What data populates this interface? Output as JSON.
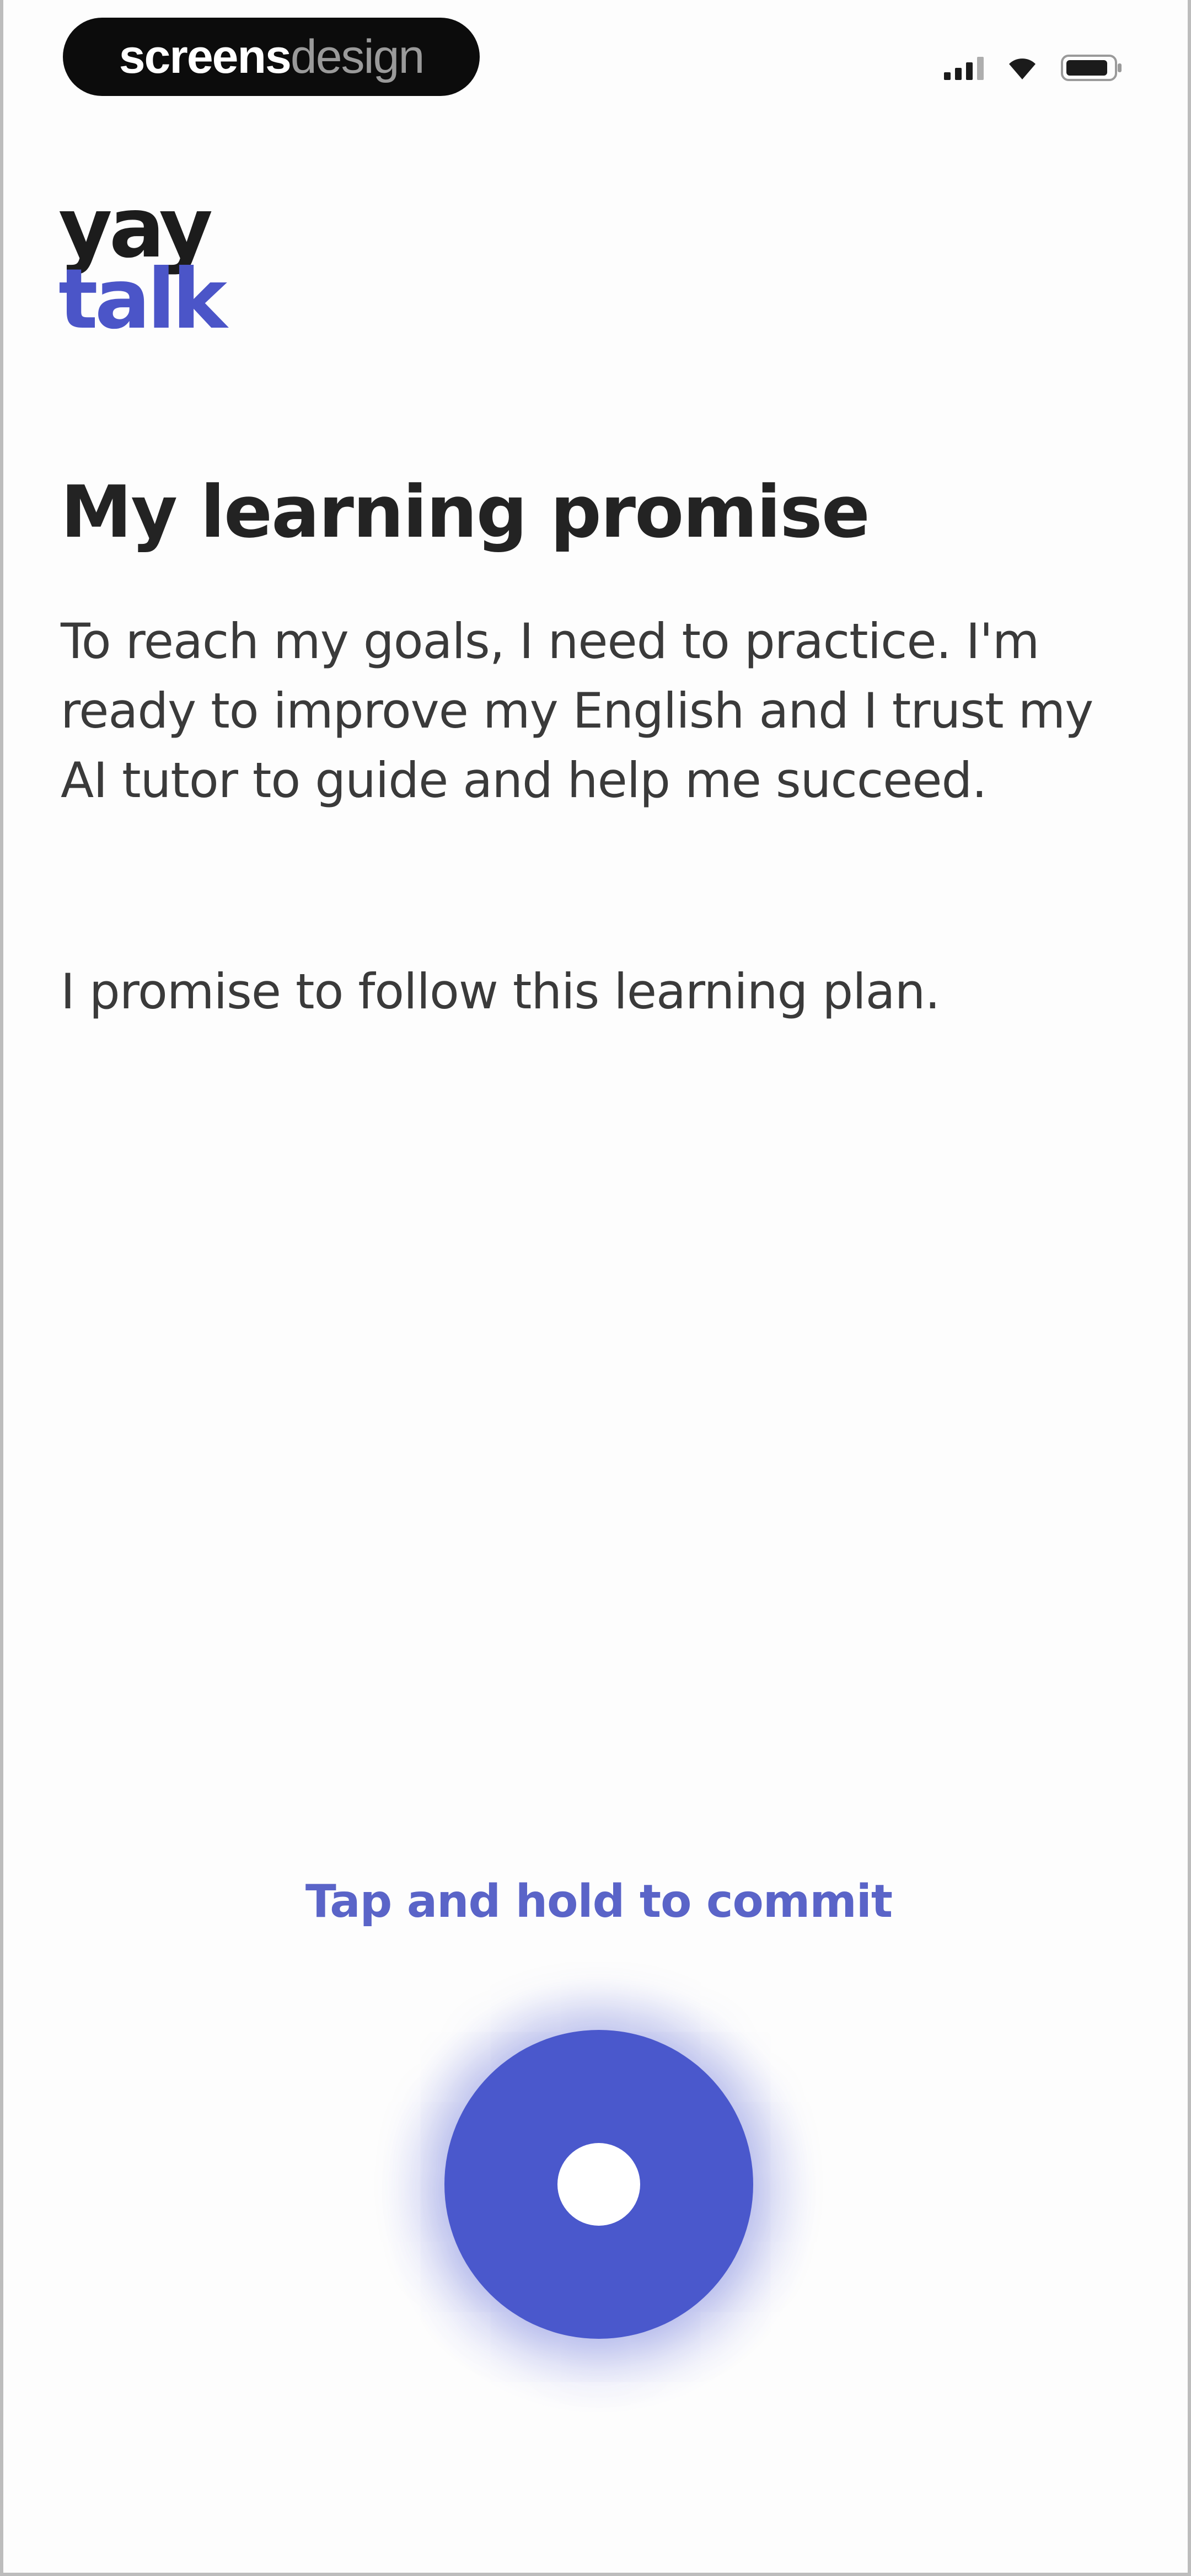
{
  "status_bar": {
    "brand_strong": "screens",
    "brand_light": "design"
  },
  "logo": {
    "line1": "yay",
    "line2": "talk",
    "colors": {
      "line1": "#1c1c1c",
      "line2": "#4b55c8"
    }
  },
  "content": {
    "title": "My learning promise",
    "paragraph1": "To reach my goals, I need to practice. I'm ready to improve my English and I trust my AI tutor to guide and help me succeed.",
    "paragraph2": "I promise to follow this learning plan."
  },
  "commit": {
    "hint": "Tap and hold to commit",
    "button_color": "#4a58cc"
  },
  "icons": [
    "signal-icon",
    "wifi-icon",
    "battery-icon",
    "commit-dot-icon"
  ]
}
